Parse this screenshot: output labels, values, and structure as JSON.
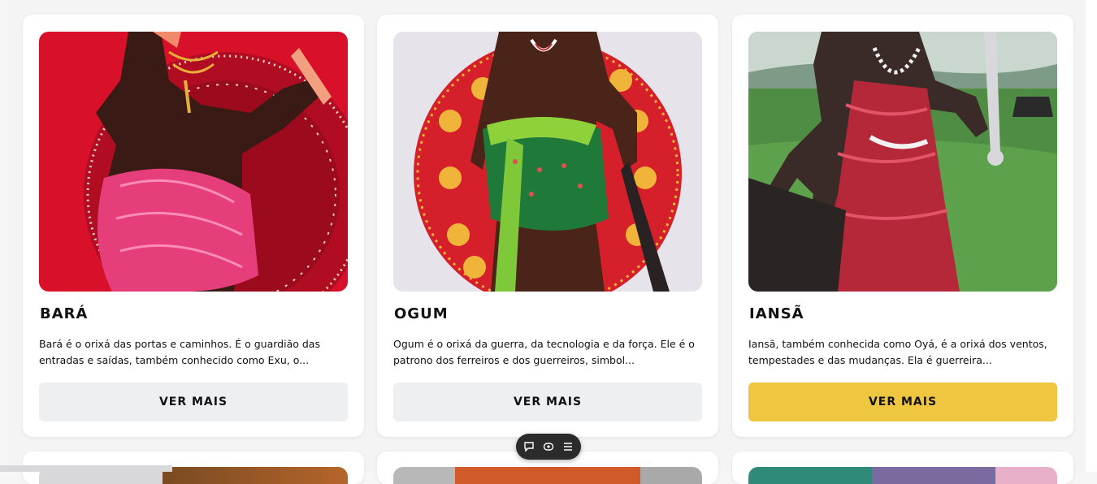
{
  "cards": [
    {
      "title": "BARÁ",
      "description": "Bará é o orixá das portas e caminhos. É o guardião das entradas e saídas, também conhecido como Exu, o...",
      "button_label": "VER MAIS",
      "image_alt": "Bará"
    },
    {
      "title": "OGUM",
      "description": "Ogum é o orixá da guerra, da tecnologia e da força. Ele é o patrono dos ferreiros e dos guerreiros, simbol...",
      "button_label": "VER MAIS",
      "image_alt": "Ogum"
    },
    {
      "title": "IANSÃ",
      "description": "Iansã, também conhecida como Oyá, é a orixá dos ventos, tempestades e das mudanças. Ela é guerreira...",
      "button_label": "VER MAIS",
      "image_alt": "Iansã"
    }
  ],
  "colors": {
    "button_default": "#eeeff1",
    "button_active": "#efc640",
    "page_background": "#f4f4f5"
  },
  "floating_toolbar": {
    "icons": [
      "chat-bubble-icon",
      "eye-icon",
      "list-icon"
    ]
  }
}
